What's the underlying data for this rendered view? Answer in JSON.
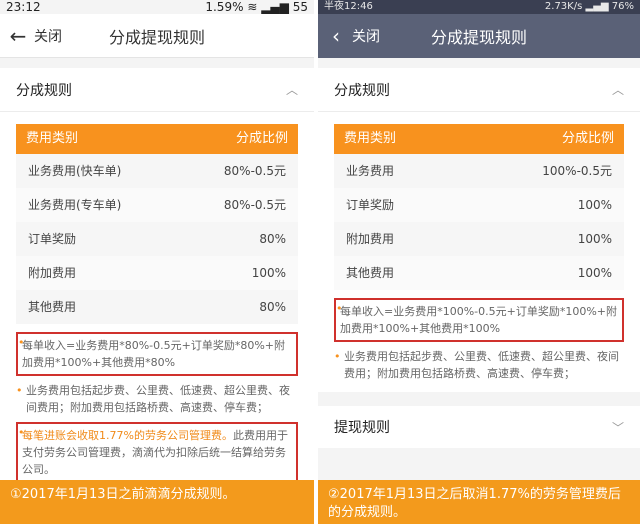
{
  "left": {
    "status": {
      "time": "23:12",
      "battery_pct": "1.59%",
      "battery_num": "55"
    },
    "nav": {
      "close_label": "关闭",
      "title": "分成提现规则"
    },
    "section_title": "分成规则",
    "table": {
      "headers": [
        "费用类别",
        "分成比例"
      ],
      "rows": [
        [
          "业务费用(快车单)",
          "80%-0.5元"
        ],
        [
          "业务费用(专车单)",
          "80%-0.5元"
        ],
        [
          "订单奖励",
          "80%"
        ],
        [
          "附加费用",
          "100%"
        ],
        [
          "其他费用",
          "80%"
        ]
      ]
    },
    "notes": [
      "每单收入=业务费用*80%-0.5元+订单奖励*80%+附加费用*100%+其他费用*80%",
      "业务费用包括起步费、公里费、低速费、超公里费、夜间费用；附加费用包括路桥费、高速费、停车费；"
    ],
    "fee_note": {
      "highlight": "每笔进账会收取1.77%的劳务公司管理费。",
      "rest": "此费用用于支付劳务公司管理费，滴滴代为扣除后统一结算给劳务公司。"
    },
    "caption": "①2017年1月13日之前滴滴分成规则。"
  },
  "right": {
    "status": {
      "carrier": "半夜12:46",
      "speed": "2.73K/s",
      "battery": "76%"
    },
    "nav": {
      "close_label": "关闭",
      "title": "分成提现规则"
    },
    "section_title": "分成规则",
    "table": {
      "headers": [
        "费用类别",
        "分成比例"
      ],
      "rows": [
        [
          "业务费用",
          "100%-0.5元"
        ],
        [
          "订单奖励",
          "100%"
        ],
        [
          "附加费用",
          "100%"
        ],
        [
          "其他费用",
          "100%"
        ]
      ]
    },
    "notes": [
      "每单收入=业务费用*100%-0.5元+订单奖励*100%+附加费用*100%+其他费用*100%",
      "业务费用包括起步费、公里费、低速费、超公里费、夜间费用；附加费用包括路桥费、高速费、停车费；"
    ],
    "section2_title": "提现规则",
    "caption": "②2017年1月13日之后取消1.77%的劳务管理费后的分成规则。"
  }
}
